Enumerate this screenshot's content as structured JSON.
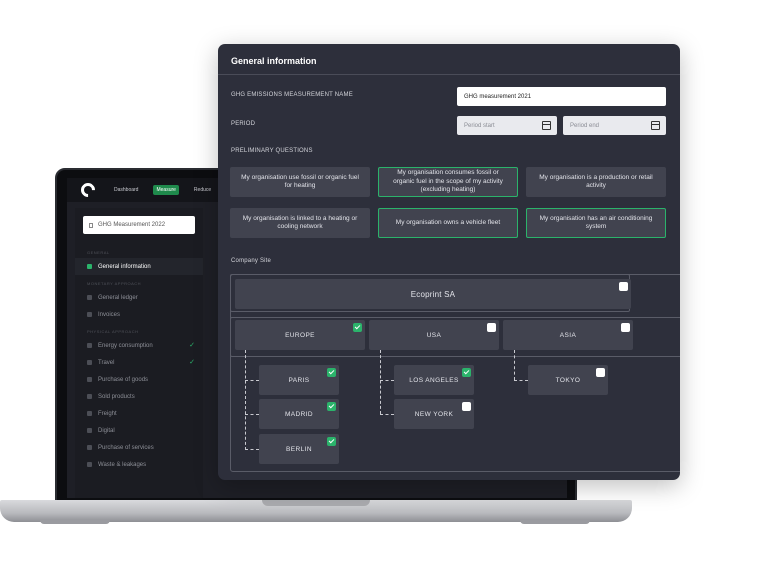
{
  "laptop": {
    "nav": [
      "Dashboard",
      "Measure",
      "Reduce"
    ],
    "active_nav": "Measure",
    "measurement_select": "GHG Measurement 2022",
    "sections": {
      "general": "GENERAL",
      "monetary": "MONETARY APPROACH",
      "physical": "PHYSICAL APPROACH"
    },
    "items": {
      "general_information": "General information",
      "general_ledger": "General ledger",
      "invoices": "Invoices",
      "energy": "Energy consumption",
      "travel": "Travel",
      "purchase_goods": "Purchase of goods",
      "sold_products": "Sold products",
      "freight": "Freight",
      "digital": "Digital",
      "purchase_services": "Purchase of services",
      "waste": "Waste & leakages"
    },
    "done_mark": "✓"
  },
  "panel": {
    "title": "General information",
    "name_label": "GHG EMISSIONS MEASUREMENT NAME",
    "name_value": "GHG measurement 2021",
    "period_label": "PERIOD",
    "period_start": "Period start",
    "period_end": "Period end",
    "questions_label": "PRELIMINARY QUESTIONS",
    "questions": [
      {
        "text": "My organisation use fossil or organic fuel for heating",
        "selected": false
      },
      {
        "text": "My organisation consumes fossil or organic fuel in the scope of my activity (excluding heating)",
        "selected": true
      },
      {
        "text": "My organisation is a production or retail activity",
        "selected": false
      },
      {
        "text": "My organisation is linked to a heating or cooling network",
        "selected": false
      },
      {
        "text": "My organisation owns a vehicle fleet",
        "selected": true
      },
      {
        "text": "My organisation has an air conditioning system",
        "selected": true
      }
    ],
    "site_label": "Company Site",
    "company": "Ecoprint SA",
    "regions": {
      "europe": "EUROPE",
      "usa": "USA",
      "asia": "ASIA"
    },
    "cities": {
      "paris": "PARIS",
      "madrid": "MADRID",
      "berlin": "BERLIN",
      "los_angeles": "LOS ANGELES",
      "new_york": "NEW YORK",
      "tokyo": "TOKYO"
    }
  },
  "colors": {
    "accent": "#2bb36b",
    "panel_bg": "#2d2f3b",
    "card_bg": "#41434f"
  }
}
